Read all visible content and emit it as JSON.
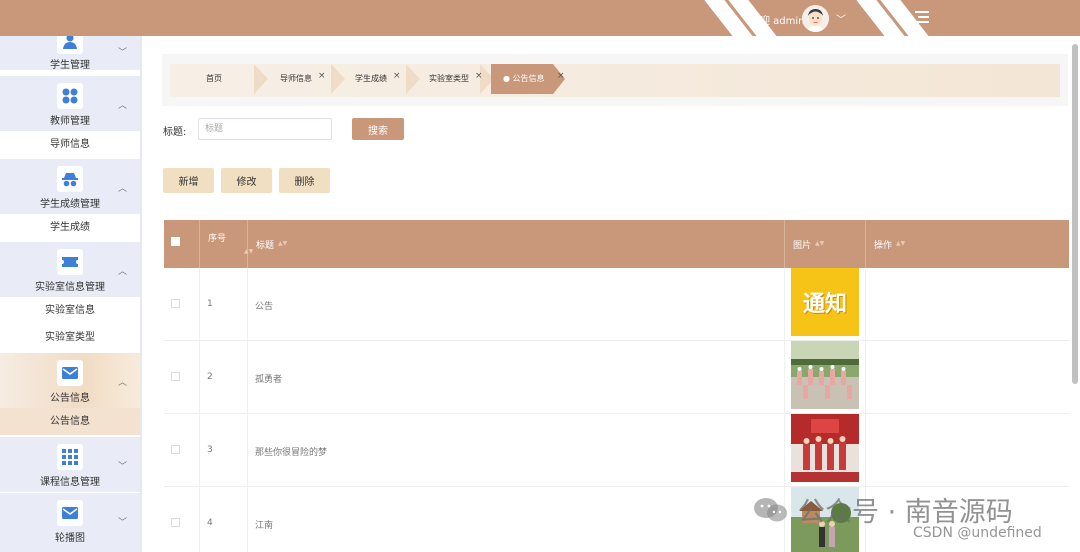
{
  "header": {
    "welcome": "欢迎 admin",
    "menu_icon": "menu-fold-icon",
    "accent_color": "#c99779"
  },
  "sidebar": {
    "groups": [
      {
        "label": "学生管理",
        "icon": "user-icon",
        "expanded": false
      },
      {
        "label": "教师管理",
        "icon": "grid-dots-icon",
        "expanded": true
      },
      {
        "label": "学生成绩管理",
        "icon": "spy-icon",
        "expanded": true
      },
      {
        "label": "实验室信息管理",
        "icon": "ticket-icon",
        "expanded": true
      },
      {
        "label": "公告信息",
        "icon": "mail-icon",
        "expanded": true
      },
      {
        "label": "课程信息管理",
        "icon": "apps-icon",
        "expanded": false
      },
      {
        "label": "轮播图",
        "icon": "mail-icon",
        "expanded": false
      }
    ],
    "subitems": [
      "导师信息",
      "学生成绩",
      "实验室信息",
      "实验室类型",
      "公告信息"
    ]
  },
  "breadcrumb": {
    "tabs": [
      "首页",
      "导师信息",
      "学生成绩",
      "实验室类型",
      "公告信息"
    ],
    "close_glyph": "×"
  },
  "search": {
    "label": "标题:",
    "placeholder": "标题",
    "button": "搜索"
  },
  "actions": {
    "add": "新增",
    "edit": "修改",
    "delete": "删除"
  },
  "table": {
    "columns": [
      "序号",
      "标题",
      "图片",
      "操作"
    ],
    "rows": [
      {
        "index": "1",
        "title": "公告",
        "image_text": "通知"
      },
      {
        "index": "2",
        "title": "孤勇者"
      },
      {
        "index": "3",
        "title": "那些你很冒险的梦"
      },
      {
        "index": "4",
        "title": "江南"
      }
    ]
  },
  "watermark": {
    "line1": "公众号 · 南音源码",
    "line2": "CSDN @undefined"
  }
}
